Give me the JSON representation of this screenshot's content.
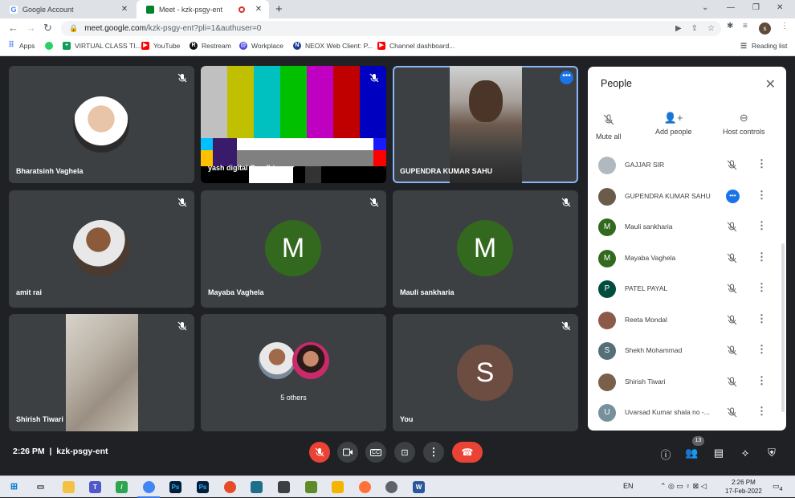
{
  "browser": {
    "tabs": [
      {
        "title": "Google Account",
        "favicon_color": "#4285f4"
      },
      {
        "title": "Meet - kzk-psgy-ent",
        "favicon_color": "#00832d"
      }
    ],
    "url_host": "meet.google.com",
    "url_path": "/kzk-psgy-ent?pli=1&authuser=0",
    "profile_initial": "s",
    "bookmarks": [
      "Apps",
      "VIRTUAL CLASS TI...",
      "YouTube",
      "Restream",
      "Workplace",
      "NEOX Web Client: P...",
      "Channel dashboard..."
    ],
    "reading_list": "Reading list"
  },
  "tiles": [
    {
      "name": "Bharatsinh Vaghela"
    },
    {
      "name": "yash digital Gandhinagar"
    },
    {
      "name": "GUPENDRA KUMAR SAHU"
    },
    {
      "name": "amit rai"
    },
    {
      "name": "Mayaba Vaghela",
      "initial": "M"
    },
    {
      "name": "Mauli sankharia",
      "initial": "M"
    },
    {
      "name": "Shirish Tiwari"
    },
    {
      "name": "5 others"
    },
    {
      "name": "You",
      "initial": "S"
    }
  ],
  "people_panel": {
    "title": "People",
    "actions": [
      "Mute all",
      "Add people",
      "Host controls"
    ],
    "participants": [
      {
        "name": "GAJJAR SIR",
        "color": "#b0b8c0",
        "initial": ""
      },
      {
        "name": "GUPENDRA KUMAR SAHU",
        "color": "#6b5b4b",
        "initial": ""
      },
      {
        "name": "Mauli sankharia",
        "color": "#33691e",
        "initial": "M"
      },
      {
        "name": "Mayaba Vaghela",
        "color": "#33691e",
        "initial": "M"
      },
      {
        "name": "PATEL PAYAL",
        "color": "#004d40",
        "initial": "P"
      },
      {
        "name": "Reeta Mondal",
        "color": "#8d5a4a",
        "initial": ""
      },
      {
        "name": "Shekh Mohammad",
        "color": "#546e7a",
        "initial": "S"
      },
      {
        "name": "Shirish Tiwari",
        "color": "#7a6048",
        "initial": ""
      },
      {
        "name": "Uvarsad Kumar shala no -...",
        "color": "#78909c",
        "initial": "U"
      }
    ]
  },
  "bottom_bar": {
    "time": "2:26 PM",
    "meeting_code": "kzk-psgy-ent",
    "people_count": "13"
  },
  "taskbar": {
    "language": "EN",
    "time": "2:26 PM",
    "date": "17-Feb-2022",
    "notification_count": "4"
  },
  "colors": {
    "accent_red": "#ea4335",
    "accent_blue": "#1a73e8",
    "tile_bg": "#3c4043",
    "meet_bg": "#202124"
  }
}
